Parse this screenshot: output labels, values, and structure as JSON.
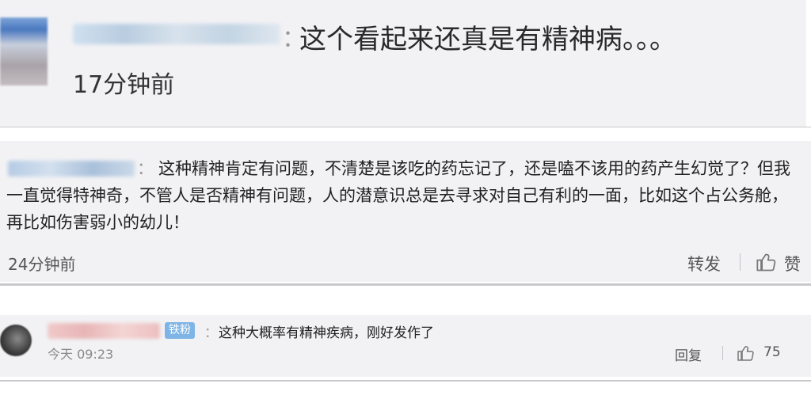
{
  "comments": [
    {
      "username": "",
      "text": "这个看起来还真是有精神病。。。",
      "time": "17分钟前"
    },
    {
      "username": "",
      "text": "这种精神肯定有问题，不清楚是该吃的药忘记了，还是嗑不该用的药产生幻觉了？但我一直觉得特神奇，不管人是否精神有问题，人的潜意识总是去寻求对自己有利的一面，比如这个占公务舱，再比如伤害弱小的幼儿！",
      "time": "24分钟前",
      "share_label": "转发",
      "like_label": "赞"
    },
    {
      "username": "",
      "badge": "铁粉",
      "text": "这种大概率有精神疾病，刚好发作了",
      "time": "今天 09:23",
      "reply_label": "回复",
      "like_count": "75"
    }
  ],
  "colon": "：",
  "icons": {
    "like": "thumbs-up-icon"
  },
  "colors": {
    "badge": "#7fb5e6",
    "card_bg": "#f2f2f5"
  }
}
